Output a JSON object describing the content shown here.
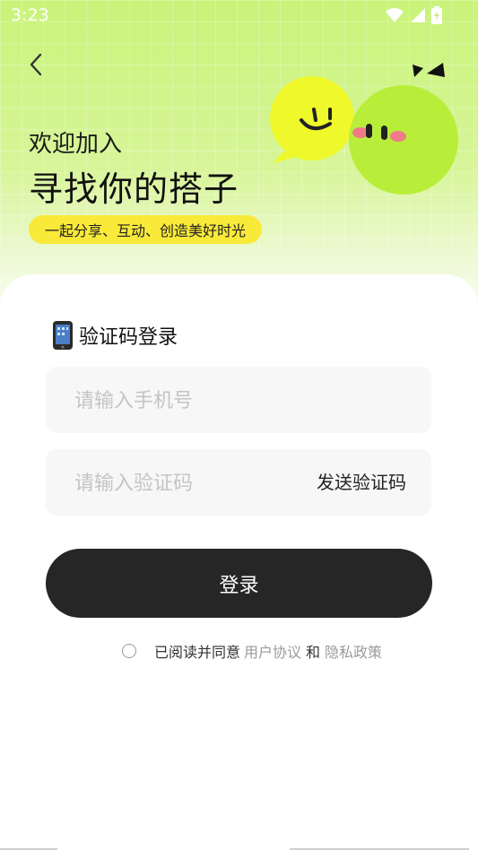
{
  "status_bar": {
    "time": "3:23",
    "icons": [
      "wifi-icon",
      "signal-icon",
      "battery-icon"
    ]
  },
  "header": {
    "welcome": "欢迎加入",
    "headline": "寻找你的搭子",
    "tagline": "一起分享、互动、创造美好时光"
  },
  "login": {
    "section_title": "验证码登录",
    "phone_placeholder": "请输入手机号",
    "code_placeholder": "请输入验证码",
    "send_code_label": "发送验证码",
    "login_label": "登录"
  },
  "agreement": {
    "prefix": "已阅读并同意",
    "user_agreement": "用户协议",
    "and": "和",
    "privacy_policy": "隐私政策"
  },
  "colors": {
    "accent_green": "#c9f37a",
    "accent_yellow": "#f9ea3a",
    "button_dark": "#262626"
  }
}
